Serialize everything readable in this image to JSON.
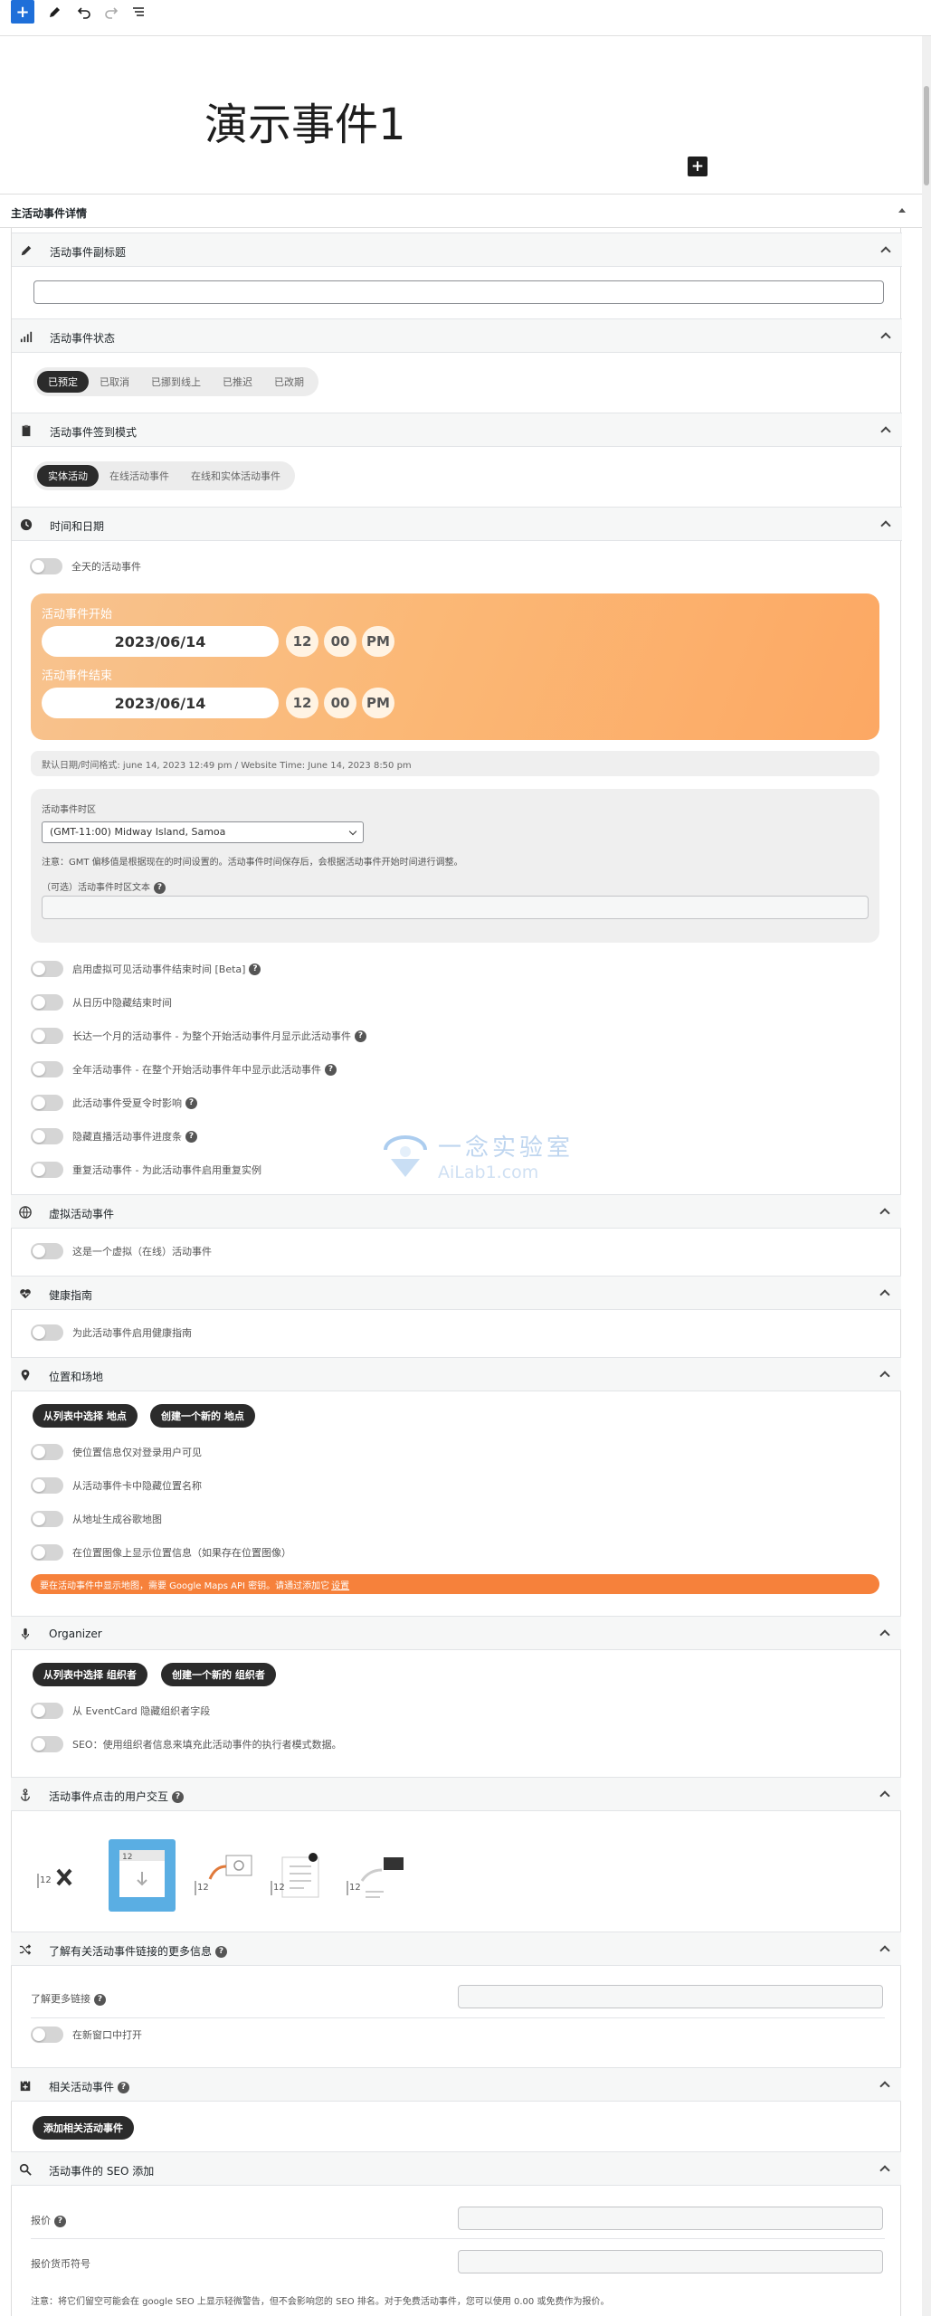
{
  "toolbar": {
    "add": "+"
  },
  "post_title": "演示事件1",
  "metabox": {
    "title": "主活动事件详情"
  },
  "sections": {
    "subtitle": {
      "label": "活动事件副标题",
      "value": ""
    },
    "status": {
      "label": "活动事件状态",
      "options": [
        "已预定",
        "已取消",
        "已挪到线上",
        "已推迟",
        "已改期"
      ],
      "selected": "已预定"
    },
    "attendance": {
      "label": "活动事件签到模式",
      "options": [
        "实体活动",
        "在线活动事件",
        "在线和实体活动事件"
      ],
      "selected": "实体活动"
    },
    "datetime": {
      "label": "时间和日期",
      "all_day": "全天的活动事件",
      "start_label": "活动事件开始",
      "start_date": "2023/06/14",
      "start_hour": "12",
      "start_min": "00",
      "start_ampm": "PM",
      "end_label": "活动事件结束",
      "end_date": "2023/06/14",
      "end_hour": "12",
      "end_min": "00",
      "end_ampm": "PM",
      "format_note": "默认日期/时间格式:   june 14, 2023 12:49 pm / Website Time: June 14, 2023 8:50 pm",
      "tz_label": "活动事件时区",
      "tz_value": "(GMT-11:00) Midway Island, Samoa",
      "tz_note": "注意：GMT 偏移值是根据现在的时间设置的。活动事件时间保存后，会根据活动事件开始时间进行调整。",
      "tz_text_label": "（可选）活动事件时区文本",
      "toggles": [
        {
          "label": "启用虚拟可见活动事件结束时间 [Beta]",
          "help": true
        },
        {
          "label": "从日历中隐藏结束时间",
          "help": false
        },
        {
          "label": "长达一个月的活动事件 - 为整个开始活动事件月显示此活动事件",
          "help": true
        },
        {
          "label": "全年活动事件 - 在整个开始活动事件年中显示此活动事件",
          "help": true
        },
        {
          "label": "此活动事件受夏令时影响",
          "help": true
        },
        {
          "label": "隐藏直播活动事件进度条",
          "help": true
        },
        {
          "label": "重复活动事件 - 为此活动事件启用重复实例",
          "help": false
        }
      ]
    },
    "virtual": {
      "label": "虚拟活动事件",
      "toggle": "这是一个虚拟（在线）活动事件"
    },
    "health": {
      "label": "健康指南",
      "toggle": "为此活动事件启用健康指南"
    },
    "location": {
      "label": "位置和场地",
      "btn_select": "从列表中选择 地点",
      "btn_create": "创建一个新的 地点",
      "toggles": [
        "使位置信息仅对登录用户可见",
        "从活动事件卡中隐藏位置名称",
        "从地址生成谷歌地图",
        "在位置图像上显示位置信息（如果存在位置图像）"
      ],
      "warning": "要在活动事件中显示地图，需要 Google Maps API 密钥。请通过添加它",
      "warning_link": "设置"
    },
    "organizer": {
      "label": "Organizer",
      "btn_select": "从列表中选择 组织者",
      "btn_create": "创建一个新的 组织者",
      "toggles": [
        "从 EventCard 隐藏组织者字段",
        "SEO：使用组织者信息来填充此活动事件的执行者模式数据。"
      ]
    },
    "interaction": {
      "label": "活动事件点击的用户交互",
      "icon_number": "12"
    },
    "learnmore": {
      "label": "了解有关活动事件链接的更多信息",
      "link_label": "了解更多链接",
      "newwin": "在新窗口中打开"
    },
    "related": {
      "label": "相关活动事件",
      "btn": "添加相关活动事件"
    },
    "seo": {
      "label": "活动事件的 SEO 添加",
      "price_label": "报价",
      "currency_label": "报价货币符号",
      "note": "注意：将它们留空可能会在 google SEO 上显示轻微警告，但不会影响您的 SEO 排名。对于免费活动事件，您可以使用 0.00 或免费作为报价。"
    }
  },
  "watermark": {
    "line1": "一念实验室",
    "line2": "AiLab1.com"
  },
  "colors": {
    "accent": "#1e6fd9",
    "date_gradient_start": "#f7c38f",
    "date_gradient_end": "#fca863",
    "warning": "#f6813b",
    "selected_interaction": "#5aaee3",
    "pill_active": "#2b2b2b"
  }
}
